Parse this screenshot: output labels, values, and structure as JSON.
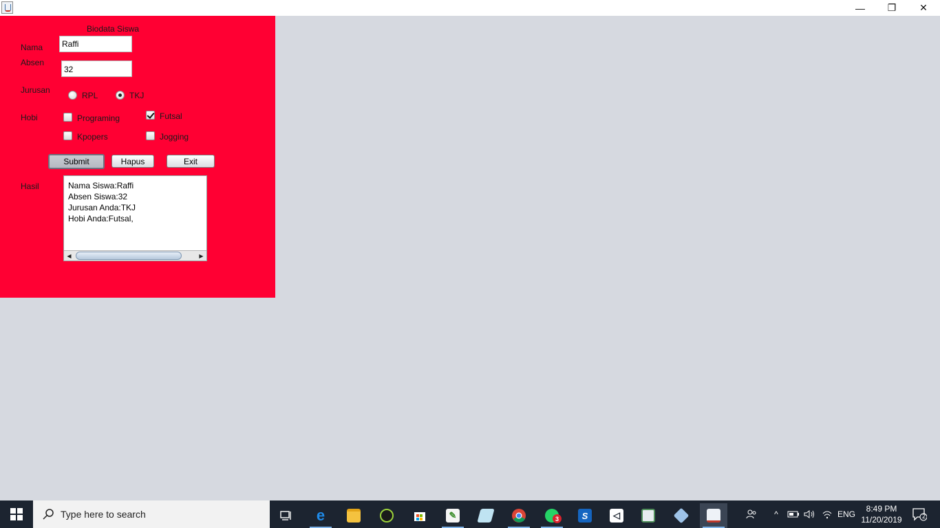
{
  "window": {
    "icon": "java-cup-icon",
    "controls": {
      "minimize": "—",
      "maximize": "❐",
      "close": "✕"
    }
  },
  "form": {
    "title": "Biodata Siswa",
    "nama_label": "Nama",
    "nama_value": "Raffi",
    "absen_label": "Absen",
    "absen_value": "32",
    "jurusan_label": "Jurusan",
    "jurusan_options": [
      {
        "label": "RPL",
        "selected": false
      },
      {
        "label": "TKJ",
        "selected": true
      }
    ],
    "hobi_label": "Hobi",
    "hobi_options": [
      {
        "label": "Programing",
        "checked": false
      },
      {
        "label": "Futsal",
        "checked": true
      },
      {
        "label": "Kpopers",
        "checked": false
      },
      {
        "label": "Jogging",
        "checked": false
      }
    ],
    "buttons": {
      "submit": "Submit",
      "hapus": "Hapus",
      "exit": "Exit"
    },
    "hasil_label": "Hasil",
    "hasil_lines": [
      "Nama Siswa:Raffi",
      "Absen Siswa:32",
      "Jurusan Anda:TKJ",
      "Hobi Anda:Futsal,"
    ]
  },
  "taskbar": {
    "search_placeholder": "Type here to search",
    "apps": [
      {
        "name": "task-view-icon"
      },
      {
        "name": "edge-icon"
      },
      {
        "name": "file-explorer-icon"
      },
      {
        "name": "ninja-app-icon"
      },
      {
        "name": "store-icon"
      },
      {
        "name": "editor-app-icon"
      },
      {
        "name": "drive-app-icon"
      },
      {
        "name": "chrome-icon"
      },
      {
        "name": "whatsapp-icon",
        "badge": "3"
      },
      {
        "name": "app-s-icon"
      },
      {
        "name": "visual-studio-icon"
      },
      {
        "name": "notepad-app-icon"
      },
      {
        "name": "virtualbox-icon"
      },
      {
        "name": "java-app-icon"
      }
    ],
    "tray": {
      "language": "ENG"
    },
    "clock": {
      "time": "8:49 PM",
      "date": "11/20/2019"
    },
    "notification_count": "2"
  },
  "colors": {
    "panel": "#ff0033",
    "desktop": "#d6d9e0",
    "taskbar": "#1c2430"
  }
}
